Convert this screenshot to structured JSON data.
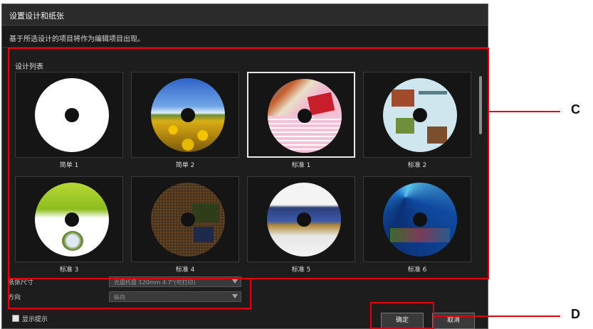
{
  "dialog": {
    "title": "设置设计和纸张",
    "description": "基于所选设计的项目将作为编辑项目出现。"
  },
  "design_list": {
    "label": "设计列表",
    "items": [
      {
        "label": "简单 1",
        "selected": false,
        "art": "plain-white"
      },
      {
        "label": "简单 2",
        "selected": false,
        "art": "sunflower-field"
      },
      {
        "label": "标准 1",
        "selected": true,
        "art": "pink-check-photos"
      },
      {
        "label": "标准 2",
        "selected": false,
        "art": "light-blue-photos"
      },
      {
        "label": "标准 3",
        "selected": false,
        "art": "green-swirl-flower"
      },
      {
        "label": "标准 4",
        "selected": false,
        "art": "brown-dots-photos"
      },
      {
        "label": "标准 5",
        "selected": false,
        "art": "city-panorama"
      },
      {
        "label": "标准 6",
        "selected": false,
        "art": "blue-rays-photos"
      }
    ]
  },
  "options": {
    "paper_size_label": "纸张尺寸",
    "paper_size_value": "光盘托盘 120mm 4.7\"(可打印)",
    "orientation_label": "方向",
    "orientation_value": "纵向"
  },
  "footer": {
    "checkbox_label": "显示提示",
    "ok_label": "确定",
    "cancel_label": "取消"
  },
  "callouts": {
    "c": "C",
    "d": "D"
  },
  "colors": {
    "highlight": "#e00016"
  }
}
